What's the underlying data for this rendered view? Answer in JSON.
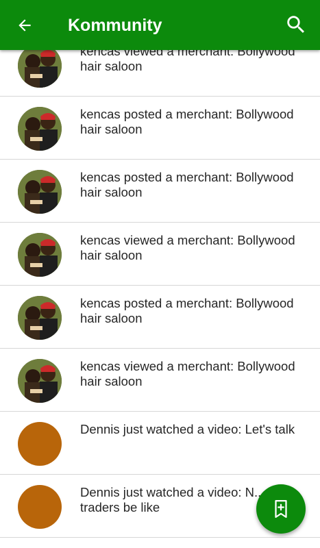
{
  "appbar": {
    "title": "Kommunity",
    "back_icon": "arrow-back-icon",
    "search_icon": "search-icon",
    "color": "#0c8a0c"
  },
  "feed": {
    "items": [
      {
        "text": "kencas viewed a merchant: Bollywood hair saloon",
        "avatar": "photo"
      },
      {
        "text": "kencas posted  a merchant: Bollywood hair saloon",
        "avatar": "photo"
      },
      {
        "text": "kencas posted  a merchant: Bollywood hair saloon",
        "avatar": "photo"
      },
      {
        "text": "kencas viewed a merchant: Bollywood hair saloon",
        "avatar": "photo"
      },
      {
        "text": "kencas posted  a merchant: Bollywood hair saloon",
        "avatar": "photo"
      },
      {
        "text": "kencas viewed a merchant: Bollywood hair saloon",
        "avatar": "photo"
      },
      {
        "text": "Dennis just watched a video: Let's talk",
        "avatar": "solid"
      },
      {
        "text": "Dennis just watched a video: N... traders be like",
        "avatar": "solid"
      }
    ]
  },
  "fab": {
    "icon": "bookmark-add-icon"
  }
}
